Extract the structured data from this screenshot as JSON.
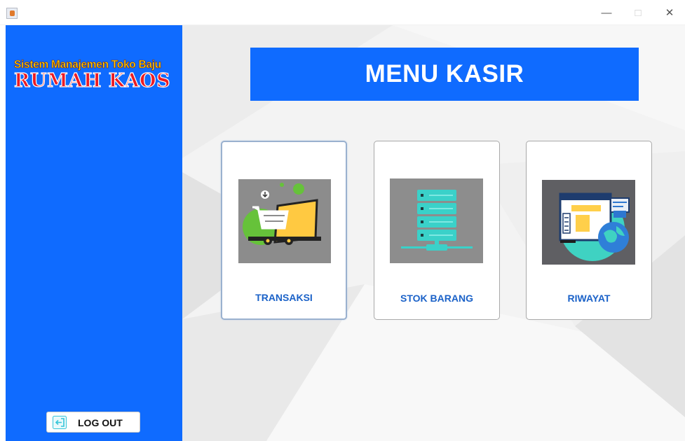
{
  "window": {
    "app_icon": "java-icon",
    "controls": {
      "minimize": "—",
      "maximize": "□",
      "close": "✕"
    }
  },
  "sidebar": {
    "brand_subtitle": "Sistem Manajemen Toko Baju",
    "brand_title": "RUMAH KAOS",
    "logout_label": "LOG OUT",
    "logout_icon": "logout-icon"
  },
  "main": {
    "title": "MENU KASIR",
    "cards": [
      {
        "label": "TRANSAKSI",
        "icon": "shopping-cart-laptop-icon"
      },
      {
        "label": "STOK BARANG",
        "icon": "server-stack-icon"
      },
      {
        "label": "RIWAYAT",
        "icon": "browser-globe-icon"
      }
    ]
  },
  "colors": {
    "primary_blue": "#0f6bff",
    "card_label": "#1b62c8",
    "brand_yellow": "#ffd700",
    "brand_red": "#ec1c24"
  }
}
